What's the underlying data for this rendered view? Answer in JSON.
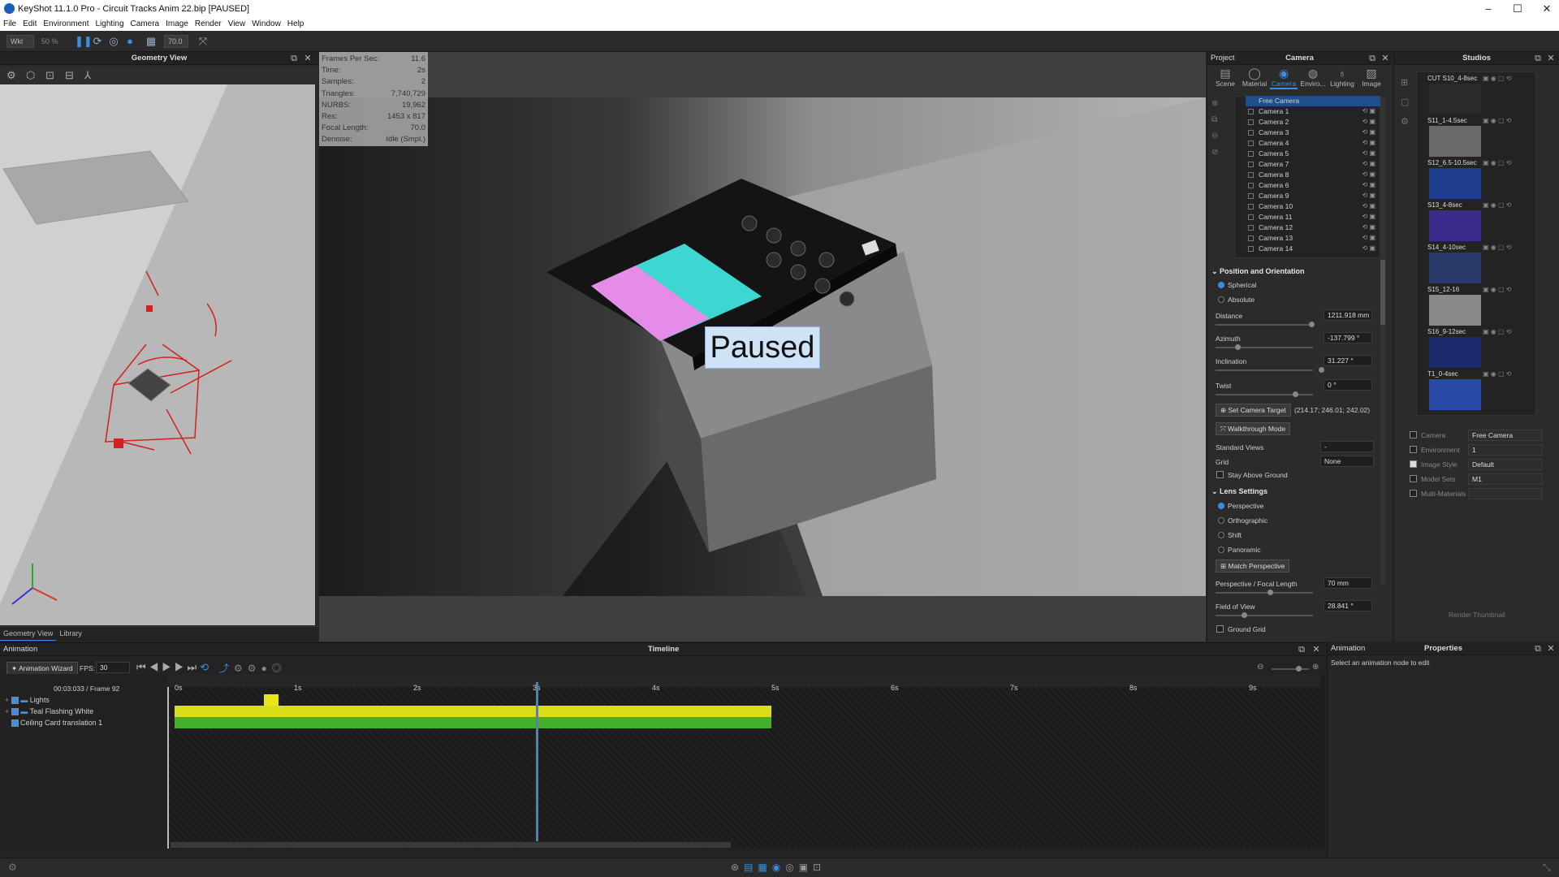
{
  "window": {
    "title": "KeyShot 11.1.0 Pro - Circuit Tracks Anim 22.bip [PAUSED]",
    "minimize": "–",
    "maximize": "☐",
    "close": "✕"
  },
  "menu": [
    "File",
    "Edit",
    "Environment",
    "Lighting",
    "Camera",
    "Image",
    "Render",
    "View",
    "Window",
    "Help"
  ],
  "toolbar": {
    "workspace": "Wkl",
    "zoom": "50 %",
    "focal": "70.0"
  },
  "geometry": {
    "title": "Geometry View",
    "tabs": [
      "Geometry View",
      "Library"
    ]
  },
  "stats": [
    {
      "k": "Frames Per Sec:",
      "v": "11.6"
    },
    {
      "k": "Time:",
      "v": "2s"
    },
    {
      "k": "Samples:",
      "v": "2"
    },
    {
      "k": "Triangles:",
      "v": "7,740,729"
    },
    {
      "k": "NURBS:",
      "v": "19,962"
    },
    {
      "k": "Res:",
      "v": "1453 x 817"
    },
    {
      "k": "Focal Length:",
      "v": "70.0"
    },
    {
      "k": "Denoise:",
      "v": "Idle (Smpl.)"
    }
  ],
  "paused": "Paused",
  "project": {
    "label": "Project",
    "title": "Camera",
    "tabs": [
      "Scene",
      "Material",
      "Camera",
      "Enviro...",
      "Lighting",
      "Image"
    ]
  },
  "cameras": [
    "Free Camera",
    "Camera 1",
    "Camera 2",
    "Camera 3",
    "Camera 4",
    "Camera 5",
    "Camera 7",
    "Camera 8",
    "Camera 6",
    "Camera 9",
    "Camera 10",
    "Camera 11",
    "Camera 12",
    "Camera 13",
    "Camera 14"
  ],
  "position": {
    "header": "Position and Orientation",
    "spherical": "Spherical",
    "absolute": "Absolute",
    "distance_label": "Distance",
    "distance": "1211.918 mm",
    "azimuth_label": "Azimuth",
    "azimuth": "-137.799 °",
    "inclination_label": "Inclination",
    "inclination": "31.227 °",
    "twist_label": "Twist",
    "twist": "0 °",
    "set_target": "Set Camera Target",
    "target_value": "(214.17; 246.01; 242.02)",
    "walkthrough": "Walkthrough Mode",
    "standard_views_label": "Standard Views",
    "standard_views": "-",
    "grid_label": "Grid",
    "grid": "None",
    "stay_above": "Stay Above Ground"
  },
  "lens": {
    "header": "Lens Settings",
    "perspective": "Perspective",
    "orthographic": "Orthographic",
    "shift": "Shift",
    "panoramic": "Panoramic",
    "match": "Match Perspective",
    "focal_label": "Perspective / Focal Length",
    "focal": "70 mm",
    "fov_label": "Field of View",
    "fov": "28.841 °",
    "ground_grid": "Ground Grid"
  },
  "studios": {
    "title": "Studios",
    "items": [
      "CUT S10_4-8sec",
      "S11_1-4.5sec",
      "S12_6.5-10.5sec",
      "S13_4-8sec",
      "S14_4-10sec",
      "S15_12-16",
      "S16_9-12sec",
      "T1_0-4sec"
    ],
    "render_thumb": "Render Thumbnail",
    "props": [
      {
        "label": "Camera",
        "value": "Free Camera",
        "checked": false
      },
      {
        "label": "Environment",
        "value": "1",
        "checked": false
      },
      {
        "label": "Image Style",
        "value": "Default",
        "checked": true
      },
      {
        "label": "Model Sets",
        "value": "M1",
        "checked": false
      },
      {
        "label": "Multi-Materials",
        "value": "",
        "checked": false
      }
    ]
  },
  "animation": {
    "label": "Animation",
    "timeline_title": "Timeline",
    "wizard": "Animation Wizard",
    "fps_label": "FPS:",
    "fps": "30",
    "time": "00:03:033 / Frame 92",
    "ticks": [
      "0s",
      "1s",
      "2s",
      "3s",
      "4s",
      "5s",
      "6s",
      "7s",
      "8s",
      "9s"
    ],
    "tracks": [
      "Lights",
      "Teal Flashing White",
      "Ceiling Card translation 1"
    ],
    "playhead_seconds": 3.03,
    "clip_end_seconds": 5.0
  },
  "properties": {
    "label": "Animation",
    "title": "Properties",
    "hint": "Select an animation node to edit"
  }
}
